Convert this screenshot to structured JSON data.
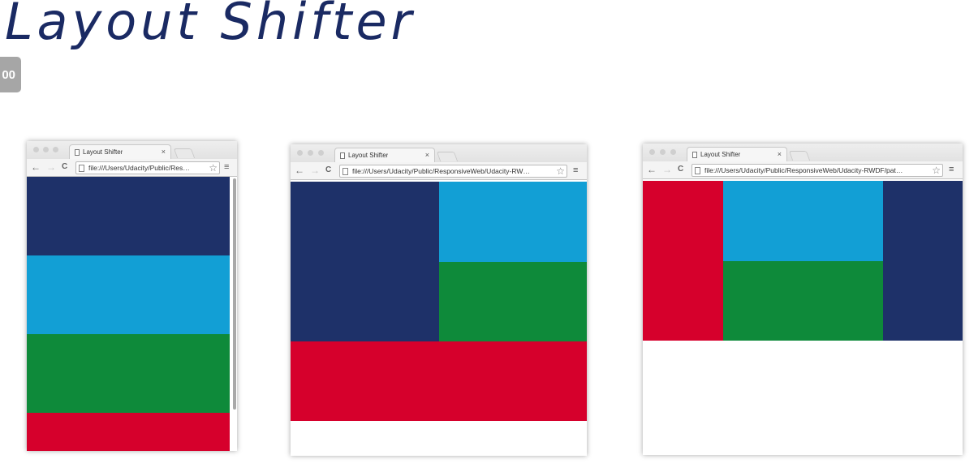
{
  "slide": {
    "title": "Layout Shifter",
    "timer_badge": "00"
  },
  "colors": {
    "navy": "#1e3169",
    "sky": "#129fd5",
    "green": "#0e8a3a",
    "red": "#d6002c"
  },
  "browsers": [
    {
      "tab_label": "Layout Shifter",
      "tab_close": "×",
      "url": "file:///Users/Udacity/Public/Res…",
      "back_icon": "←",
      "forward_icon": "→",
      "reload_icon": "C",
      "star_icon": "☆",
      "menu_icon": "≡"
    },
    {
      "tab_label": "Layout Shifter",
      "tab_close": "×",
      "url": "file:///Users/Udacity/Public/ResponsiveWeb/Udacity-RW…",
      "back_icon": "←",
      "forward_icon": "→",
      "reload_icon": "C",
      "star_icon": "☆",
      "menu_icon": "≡"
    },
    {
      "tab_label": "Layout Shifter",
      "tab_close": "×",
      "url": "file:///Users/Udacity/Public/ResponsiveWeb/Udacity-RWDF/pat…",
      "back_icon": "←",
      "forward_icon": "→",
      "reload_icon": "C",
      "star_icon": "☆",
      "menu_icon": "≡"
    }
  ]
}
